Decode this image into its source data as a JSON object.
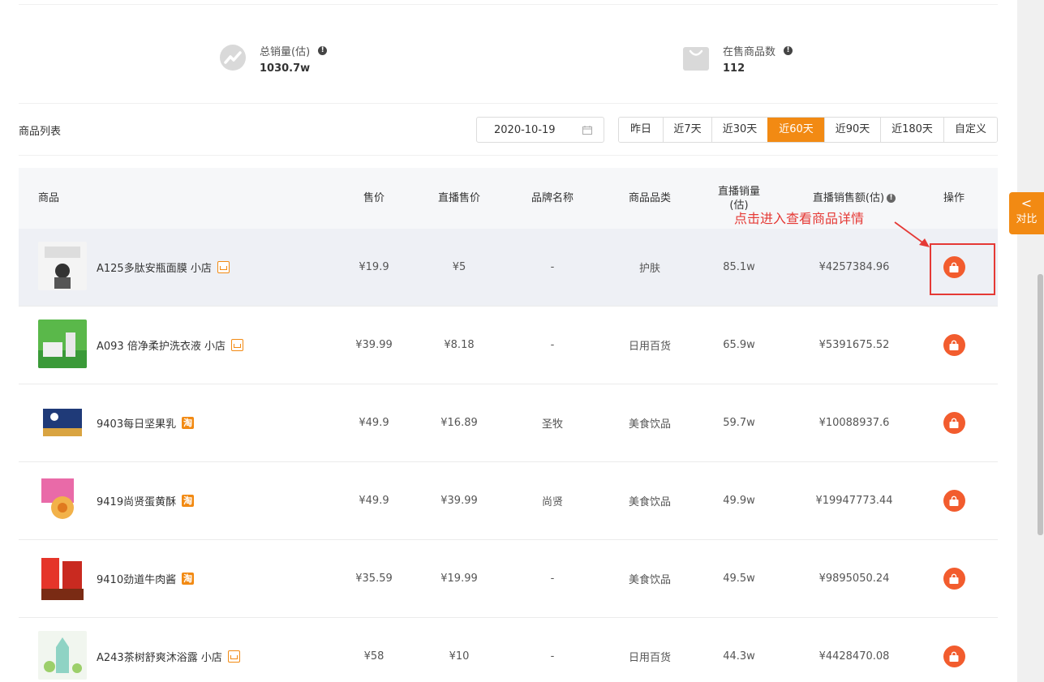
{
  "stats": [
    {
      "label": "总销量(估)",
      "value": "1030.7w",
      "icon": "trend-icon"
    },
    {
      "label": "在售商品数",
      "value": "112",
      "icon": "shopping-bag-icon"
    }
  ],
  "list_title": "商品列表",
  "date_picker": {
    "value": "2020-10-19"
  },
  "ranges": [
    "昨日",
    "近7天",
    "近30天",
    "近60天",
    "近90天",
    "近180天",
    "自定义"
  ],
  "active_range": "近60天",
  "columns": {
    "product": "商品",
    "price": "售价",
    "live_price": "直播售价",
    "brand": "品牌名称",
    "category": "商品品类",
    "live_sales": "直播销量(估)",
    "live_revenue": "直播销售额(估)",
    "action": "操作"
  },
  "rows": [
    {
      "name": "A125多肽安瓶面膜 小店",
      "badge": "shop",
      "price": "¥19.9",
      "live_price": "¥5",
      "brand": "-",
      "category": "护肤",
      "sales": "85.1w",
      "revenue": "¥4257384.96"
    },
    {
      "name": "A093 倍净柔护洗衣液 小店",
      "badge": "shop",
      "price": "¥39.99",
      "live_price": "¥8.18",
      "brand": "-",
      "category": "日用百货",
      "sales": "65.9w",
      "revenue": "¥5391675.52"
    },
    {
      "name": "9403每日坚果乳",
      "badge": "tao",
      "price": "¥49.9",
      "live_price": "¥16.89",
      "brand": "圣牧",
      "category": "美食饮品",
      "sales": "59.7w",
      "revenue": "¥10088937.6"
    },
    {
      "name": "9419尚贤蛋黄酥",
      "badge": "tao",
      "price": "¥49.9",
      "live_price": "¥39.99",
      "brand": "尚贤",
      "category": "美食饮品",
      "sales": "49.9w",
      "revenue": "¥19947773.44"
    },
    {
      "name": "9410劲道牛肉酱",
      "badge": "tao",
      "price": "¥35.59",
      "live_price": "¥19.99",
      "brand": "-",
      "category": "美食饮品",
      "sales": "49.5w",
      "revenue": "¥9895050.24"
    },
    {
      "name": "A243茶树舒爽沐浴露 小店",
      "badge": "shop",
      "price": "¥58",
      "live_price": "¥10",
      "brand": "-",
      "category": "日用百货",
      "sales": "44.3w",
      "revenue": "¥4428470.08"
    }
  ],
  "tao_badge_text": "淘",
  "annotation": "点击进入查看商品详情",
  "side_tab": {
    "label": "对比",
    "chevron": "<"
  },
  "colors": {
    "accent": "#f28a13",
    "action": "#f25c2e",
    "annotation": "#e53935"
  }
}
